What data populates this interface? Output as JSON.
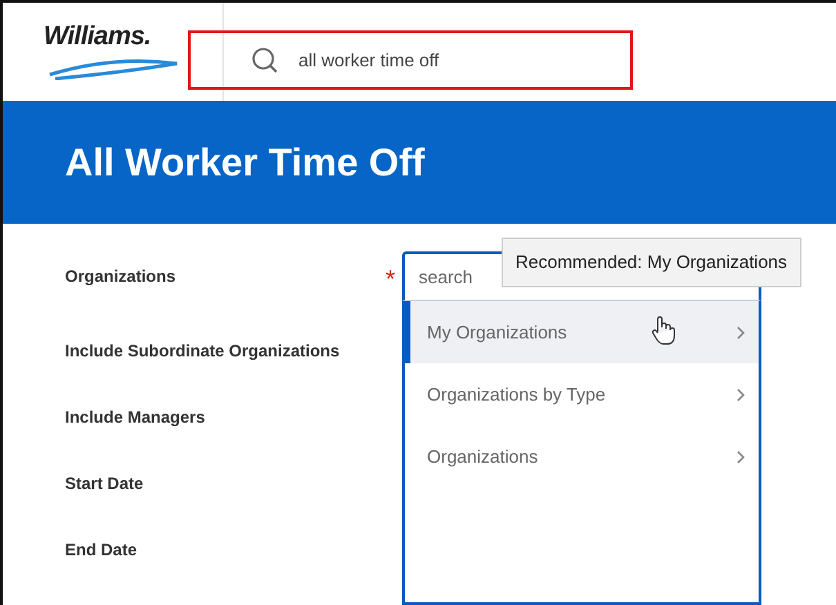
{
  "logo": {
    "text": "Williams."
  },
  "search": {
    "value": "all worker time off",
    "highlighted": true
  },
  "title": "All Worker Time Off",
  "required_marker": "*",
  "fields": [
    {
      "label": "Organizations",
      "required": true
    },
    {
      "label": "Include Subordinate Organizations",
      "required": false
    },
    {
      "label": "Include Managers",
      "required": false
    },
    {
      "label": "Start Date",
      "required": false
    },
    {
      "label": "End Date",
      "required": false
    }
  ],
  "prompt": {
    "placeholder": "search",
    "tooltip": "Recommended: My Organizations",
    "options": [
      {
        "label": "My Organizations",
        "selected": true
      },
      {
        "label": "Organizations by Type",
        "selected": false
      },
      {
        "label": "Organizations",
        "selected": false
      }
    ]
  }
}
